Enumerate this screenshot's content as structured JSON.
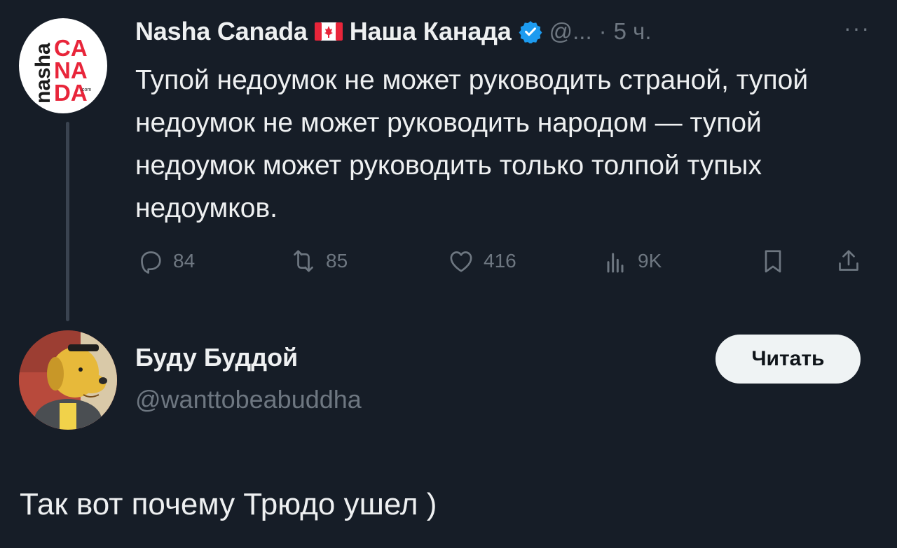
{
  "parent_tweet": {
    "author_name": "Nasha Canada",
    "author_name_ru": "Наша Канада",
    "handle": "@...",
    "separator": "·",
    "time": "5 ч.",
    "more": "···",
    "text": "Тупой недоумок не может руководить страной, тупой недоумок не может руководить народом — тупой недоумок может руководить только толпой тупых недоумков.",
    "avatar_logo_side": "nasha",
    "avatar_logo_lines": [
      "CA",
      "NA",
      "DA"
    ],
    "avatar_logo_small": ".com",
    "stats": {
      "replies": "84",
      "retweets": "85",
      "likes": "416",
      "views": "9K"
    }
  },
  "follow_suggestion": {
    "name": "Буду Буддой",
    "handle": "@wanttobeabuddha",
    "button_label": "Читать"
  },
  "caption": "Так вот почему Трюдо ушел )",
  "colors": {
    "background": "#161d27",
    "text": "#eef0f1",
    "muted": "#6e7781",
    "verified": "#1d9bf0",
    "logo_red": "#e8253a",
    "button_bg": "#eff3f4"
  }
}
